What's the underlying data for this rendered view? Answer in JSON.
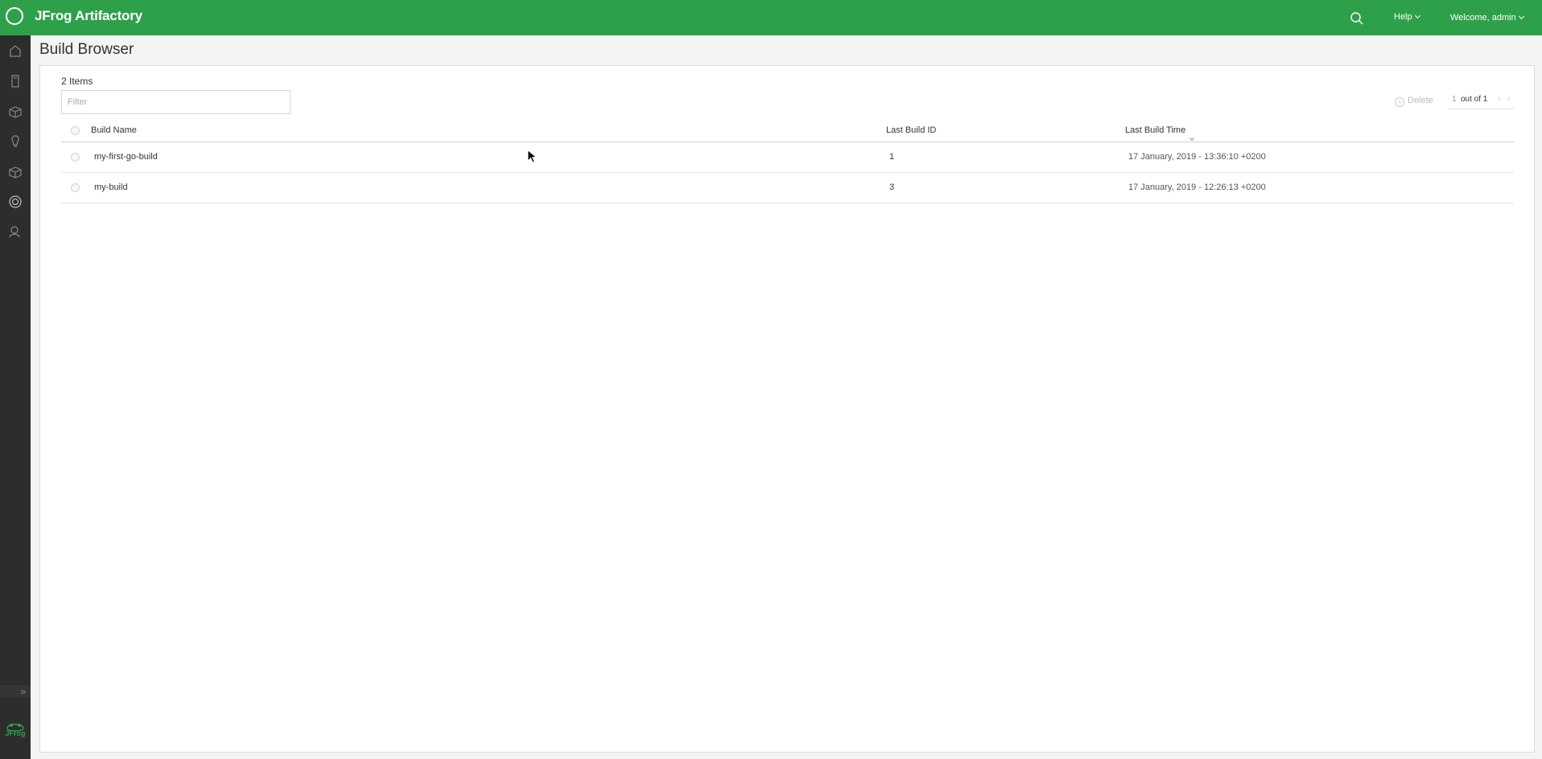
{
  "header": {
    "brand": "JFrog Artifactory",
    "help_label": "Help",
    "welcome_label": "Welcome, admin",
    "brand_color": "#2fa04a"
  },
  "sidebar": {
    "icons": [
      "home-icon",
      "artifacts-icon",
      "builds-icon",
      "xray-icon",
      "packages-icon",
      "distribution-icon",
      "admin-icon"
    ],
    "expand_glyph": "»",
    "logo_text": "JFrog"
  },
  "page": {
    "title": "Build Browser",
    "items_count": "2 Items",
    "filter_placeholder": "Filter",
    "delete_label": "Delete",
    "pager": {
      "page": "1",
      "out_of": "out of 1"
    }
  },
  "table": {
    "columns": [
      "Build Name",
      "Last Build ID",
      "Last Build Time"
    ],
    "rows": [
      {
        "name": "my-first-go-build",
        "id": "1",
        "time": "17 January, 2019 - 13:36:10 +0200"
      },
      {
        "name": "my-build",
        "id": "3",
        "time": "17 January, 2019 - 12:26:13 +0200"
      }
    ]
  }
}
